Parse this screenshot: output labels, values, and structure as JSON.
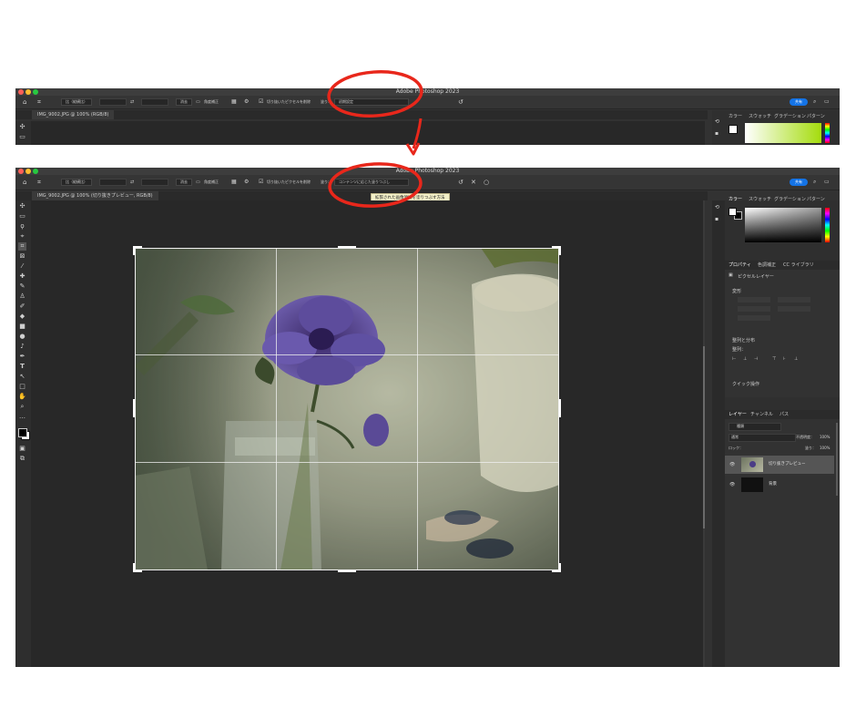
{
  "app_title": "Adobe Photoshop 2023",
  "colors": {
    "accent_blue": "#1473e6",
    "annotation_red": "#e8271b",
    "tooltip_bg": "#f3f0c8"
  },
  "options_bar": {
    "ratio_dropdown": "比（縦横比）",
    "clear_button": "消去",
    "straighten_label": "角度補正",
    "delete_cropped_label": "切り抜いたピクセルを削除",
    "fill_label": "塗り:",
    "fill_value_before": "初期設定",
    "fill_value_after": "コンテンツに応じた塗りつぶし",
    "share_button": "共有"
  },
  "tooltip": "拡張された画像領域を塗りつぶす方法",
  "document_tab_before": "IMG_9002.JPG @ 100% (RGB/8)",
  "document_tab_after": "IMG_9002.JPG @ 100% (切り抜きプレビュー, RGB/8)",
  "color_panel_tabs": [
    "カラー",
    "スウォッチ",
    "グラデーション",
    "パターン"
  ],
  "properties_panel": {
    "tabs": [
      "プロパティ",
      "色調補正",
      "CC ライブラリ"
    ],
    "layer_type": "ピクセルレイヤー",
    "transform_header": "変形",
    "align_header": "整列と分布",
    "align_sub": "整列：",
    "quick_actions_header": "クイック操作"
  },
  "layers_panel": {
    "tabs": [
      "レイヤー",
      "チャンネル",
      "パス"
    ],
    "kind_label": "種類",
    "blend_mode": "通常",
    "opacity_label": "不透明度：",
    "opacity_value": "100%",
    "lock_label": "ロック：",
    "fill_label": "塗り：",
    "fill_value": "100%",
    "layers": [
      {
        "name": "切り抜きプレビュー"
      },
      {
        "name": "背景"
      }
    ]
  },
  "tools": [
    "move-icon",
    "marquee-icon",
    "lasso-icon",
    "quick-select-icon",
    "crop-icon",
    "frame-icon",
    "eyedropper-icon",
    "healing-icon",
    "brush-icon",
    "stamp-icon",
    "history-brush-icon",
    "eraser-icon",
    "gradient-icon",
    "blur-icon",
    "dodge-icon",
    "pen-icon",
    "type-icon",
    "path-select-icon",
    "rectangle-icon",
    "hand-icon",
    "zoom-icon",
    "more-tools-icon"
  ]
}
